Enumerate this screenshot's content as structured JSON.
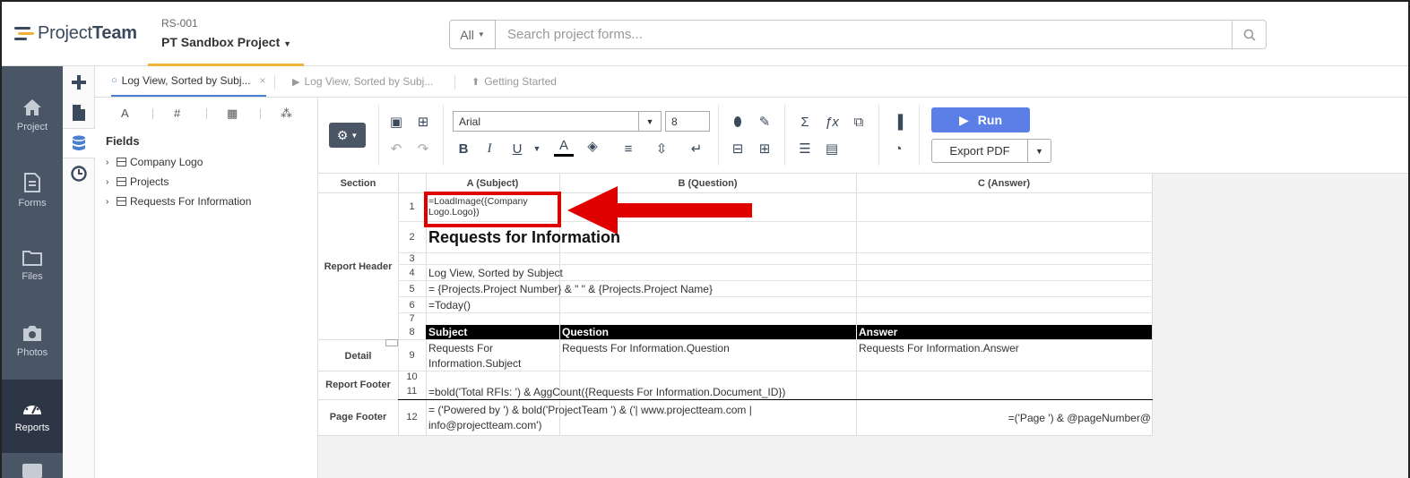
{
  "app": {
    "logo_project": "Project",
    "logo_team": "Team"
  },
  "project": {
    "code": "RS-001",
    "name": "PT Sandbox Project"
  },
  "search": {
    "scope": "All",
    "placeholder": "Search project forms..."
  },
  "nav": [
    {
      "label": "Project",
      "icon": "home-icon"
    },
    {
      "label": "Forms",
      "icon": "form-icon"
    },
    {
      "label": "Files",
      "icon": "folder-icon"
    },
    {
      "label": "Photos",
      "icon": "camera-icon"
    },
    {
      "label": "Reports",
      "icon": "gauge-icon"
    }
  ],
  "tabs": [
    {
      "label": "Log View, Sorted by Subj...",
      "icon": "circle-icon"
    },
    {
      "label": "Log View, Sorted by Subj...",
      "icon": "play-icon"
    },
    {
      "label": "Getting Started",
      "icon": "up-icon"
    }
  ],
  "fields_panel": {
    "title": "Fields",
    "items": [
      "Company Logo",
      "Projects",
      "Requests For Information"
    ]
  },
  "ribbon": {
    "font": "Arial",
    "size": "8",
    "run": "Run",
    "export": "Export PDF"
  },
  "grid": {
    "headers": {
      "section": "Section",
      "a": "A (Subject)",
      "b": "B (Question)",
      "c": "C (Answer)"
    },
    "sections": {
      "header": "Report Header",
      "detail": "Detail",
      "footer": "Report Footer",
      "page_footer": "Page Footer"
    },
    "rows": {
      "r1": "=LoadImage({Company Logo.Logo})",
      "r2": "Requests for Information",
      "r4": "Log View, Sorted by Subject",
      "r5": "= {Projects.Project Number} & \" \" & {Projects.Project Name}",
      "r6": "=Today()",
      "r8a": "Subject",
      "r8b": "Question",
      "r8c": "Answer",
      "r9a": "Requests For Information.Subject",
      "r9b": "Requests For Information.Question",
      "r9c": "Requests For Information.Answer",
      "r11": "=bold('Total RFIs: ') & AggCount({Requests For Information.Document_ID})",
      "r12a": "= ('Powered by ') & bold('ProjectTeam ') & ('| www.projectteam.com | info@projectteam.com')",
      "r12c": "=('Page ') & @pageNumber@"
    },
    "row_numbers": [
      "1",
      "2",
      "3",
      "4",
      "5",
      "6",
      "7",
      "8",
      "9",
      "10",
      "11",
      "12"
    ]
  },
  "colors": {
    "accent": "#5b7fe6",
    "nav_bg": "#4a5566",
    "nav_active": "#2d3644",
    "highlight": "#e00000",
    "underline": "#f0b33a"
  }
}
